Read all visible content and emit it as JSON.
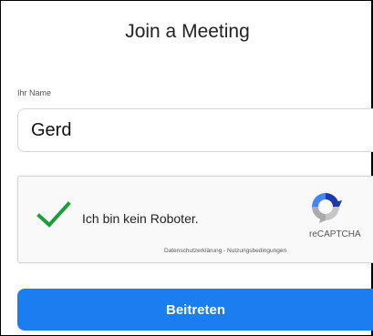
{
  "dialog": {
    "title": "Join a Meeting"
  },
  "name_field": {
    "label": "Ihr Name",
    "value": "Gerd"
  },
  "captcha": {
    "label": "Ich bin kein Roboter.",
    "brand": "reCAPTCHA",
    "privacy_link": "Datenschutzerklärung",
    "separator": " - ",
    "terms_link": "Nutzungsbedingungen",
    "checked": true,
    "check_color": "#1e9e3b"
  },
  "join_button": {
    "label": "Beitreten",
    "color": "#1a7df0"
  }
}
